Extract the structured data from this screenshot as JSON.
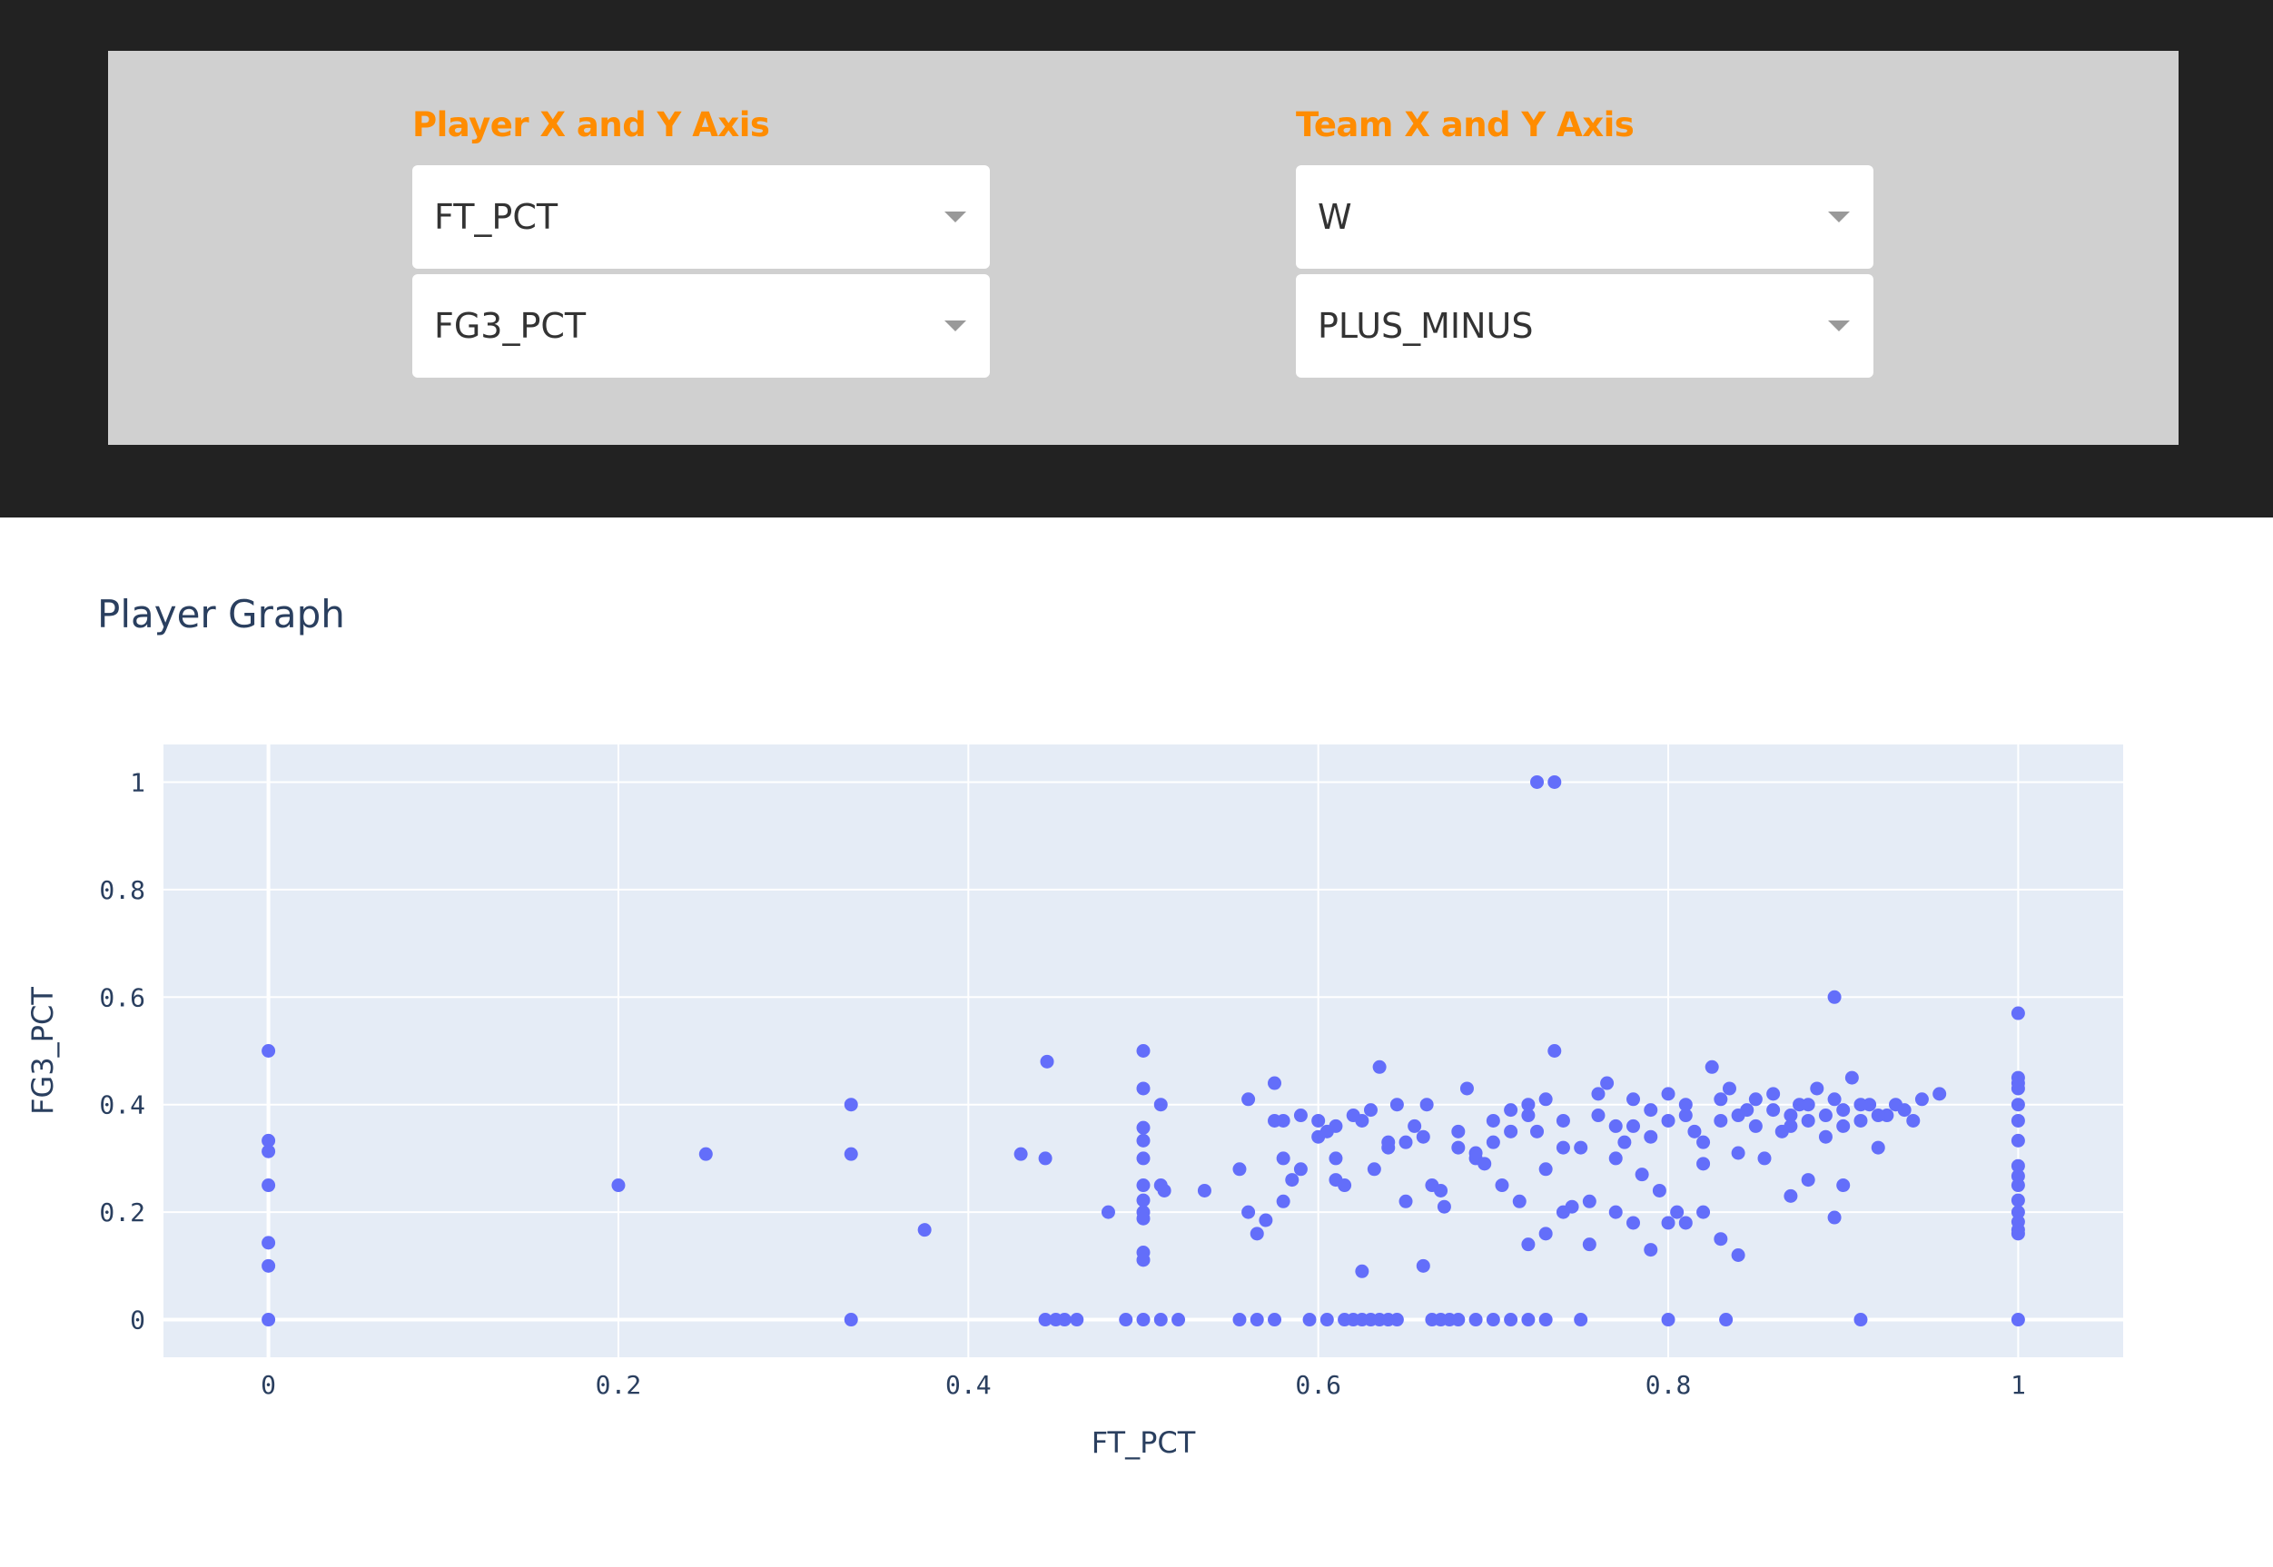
{
  "controls": {
    "player": {
      "label": "Player X and Y Axis",
      "x_value": "FT_PCT",
      "y_value": "FG3_PCT"
    },
    "team": {
      "label": "Team X and Y Axis",
      "x_value": "W",
      "y_value": "PLUS_MINUS"
    },
    "label_color": "#ff8c00"
  },
  "graph": {
    "title": "Player Graph"
  },
  "chart_data": {
    "type": "scatter",
    "title": "Player Graph",
    "xlabel": "FT_PCT",
    "ylabel": "FG3_PCT",
    "xlim": [
      -0.06,
      1.06
    ],
    "ylim": [
      -0.07,
      1.07
    ],
    "xticks": [
      0,
      0.2,
      0.4,
      0.6,
      0.8,
      1
    ],
    "yticks": [
      0,
      0.2,
      0.4,
      0.6,
      0.8,
      1
    ],
    "xtick_labels": [
      "0",
      "0.2",
      "0.4",
      "0.6",
      "0.8",
      "1"
    ],
    "ytick_labels": [
      "0",
      "0.2",
      "0.4",
      "0.6",
      "0.8",
      "1"
    ],
    "grid": true,
    "marker_color": "#636efa",
    "plot_bg": "#e5ecf6",
    "points": [
      [
        0,
        0.5
      ],
      [
        0,
        0.333
      ],
      [
        0,
        0.313
      ],
      [
        0,
        0.25
      ],
      [
        0,
        0.143
      ],
      [
        0,
        0.1
      ],
      [
        0,
        0
      ],
      [
        0.2,
        0.25
      ],
      [
        0.25,
        0.308
      ],
      [
        0.333,
        0.4
      ],
      [
        0.333,
        0.308
      ],
      [
        0.333,
        0
      ],
      [
        0.375,
        0.167
      ],
      [
        0.43,
        0.308
      ],
      [
        0.444,
        0.3
      ],
      [
        0.445,
        0.48
      ],
      [
        0.444,
        0
      ],
      [
        0.45,
        0
      ],
      [
        0.455,
        0
      ],
      [
        0.462,
        0
      ],
      [
        0.48,
        0.2
      ],
      [
        0.5,
        0.5
      ],
      [
        0.5,
        0.43
      ],
      [
        0.5,
        0.357
      ],
      [
        0.5,
        0.333
      ],
      [
        0.5,
        0.3
      ],
      [
        0.5,
        0.25
      ],
      [
        0.5,
        0.222
      ],
      [
        0.5,
        0.2
      ],
      [
        0.5,
        0.188
      ],
      [
        0.5,
        0.125
      ],
      [
        0.5,
        0.111
      ],
      [
        0.5,
        0
      ],
      [
        0.49,
        0
      ],
      [
        0.51,
        0
      ],
      [
        0.52,
        0
      ],
      [
        0.51,
        0.4
      ],
      [
        0.51,
        0.25
      ],
      [
        0.512,
        0.24
      ],
      [
        0.535,
        0.24
      ],
      [
        0.555,
        0.28
      ],
      [
        0.56,
        0.41
      ],
      [
        0.56,
        0.2
      ],
      [
        0.565,
        0.16
      ],
      [
        0.57,
        0.185
      ],
      [
        0.575,
        0.44
      ],
      [
        0.575,
        0.37
      ],
      [
        0.58,
        0.37
      ],
      [
        0.585,
        0.26
      ],
      [
        0.59,
        0.38
      ],
      [
        0.59,
        0.28
      ],
      [
        0.6,
        0.37
      ],
      [
        0.6,
        0.34
      ],
      [
        0.605,
        0.35
      ],
      [
        0.61,
        0.26
      ],
      [
        0.61,
        0.3
      ],
      [
        0.615,
        0.25
      ],
      [
        0.62,
        0.38
      ],
      [
        0.625,
        0.37
      ],
      [
        0.63,
        0.39
      ],
      [
        0.632,
        0.28
      ],
      [
        0.635,
        0.47
      ],
      [
        0.64,
        0.32
      ],
      [
        0.645,
        0.4
      ],
      [
        0.65,
        0.33
      ],
      [
        0.655,
        0.36
      ],
      [
        0.66,
        0.34
      ],
      [
        0.662,
        0.4
      ],
      [
        0.665,
        0.25
      ],
      [
        0.67,
        0.24
      ],
      [
        0.672,
        0.21
      ],
      [
        0.68,
        0.32
      ],
      [
        0.685,
        0.43
      ],
      [
        0.69,
        0.3
      ],
      [
        0.695,
        0.29
      ],
      [
        0.7,
        0.37
      ],
      [
        0.705,
        0.25
      ],
      [
        0.71,
        0.39
      ],
      [
        0.715,
        0.22
      ],
      [
        0.72,
        0.4
      ],
      [
        0.725,
        0.35
      ],
      [
        0.73,
        0.28
      ],
      [
        0.735,
        0.5
      ],
      [
        0.74,
        0.37
      ],
      [
        0.745,
        0.21
      ],
      [
        0.75,
        0.32
      ],
      [
        0.755,
        0.14
      ],
      [
        0.76,
        0.38
      ],
      [
        0.765,
        0.44
      ],
      [
        0.77,
        0.36
      ],
      [
        0.775,
        0.33
      ],
      [
        0.78,
        0.41
      ],
      [
        0.785,
        0.27
      ],
      [
        0.79,
        0.39
      ],
      [
        0.795,
        0.24
      ],
      [
        0.8,
        0.42
      ],
      [
        0.805,
        0.2
      ],
      [
        0.81,
        0.38
      ],
      [
        0.815,
        0.35
      ],
      [
        0.82,
        0.29
      ],
      [
        0.825,
        0.47
      ],
      [
        0.83,
        0.37
      ],
      [
        0.835,
        0.43
      ],
      [
        0.84,
        0.31
      ],
      [
        0.845,
        0.39
      ],
      [
        0.85,
        0.36
      ],
      [
        0.855,
        0.3
      ],
      [
        0.86,
        0.42
      ],
      [
        0.865,
        0.35
      ],
      [
        0.87,
        0.38
      ],
      [
        0.875,
        0.4
      ],
      [
        0.88,
        0.37
      ],
      [
        0.885,
        0.43
      ],
      [
        0.89,
        0.34
      ],
      [
        0.895,
        0.41
      ],
      [
        0.9,
        0.39
      ],
      [
        0.905,
        0.45
      ],
      [
        0.91,
        0.37
      ],
      [
        0.915,
        0.4
      ],
      [
        0.92,
        0.32
      ],
      [
        0.925,
        0.38
      ],
      [
        0.93,
        0.4
      ],
      [
        0.935,
        0.39
      ],
      [
        0.94,
        0.37
      ],
      [
        0.945,
        0.41
      ],
      [
        0.955,
        0.42
      ],
      [
        0.72,
        0.14
      ],
      [
        0.73,
        0.16
      ],
      [
        0.74,
        0.2
      ],
      [
        0.755,
        0.22
      ],
      [
        0.77,
        0.2
      ],
      [
        0.78,
        0.18
      ],
      [
        0.79,
        0.13
      ],
      [
        0.8,
        0.18
      ],
      [
        0.81,
        0.18
      ],
      [
        0.82,
        0.2
      ],
      [
        0.83,
        0.15
      ],
      [
        0.84,
        0.12
      ],
      [
        0.87,
        0.23
      ],
      [
        0.88,
        0.26
      ],
      [
        0.895,
        0.19
      ],
      [
        0.9,
        0.25
      ],
      [
        0.66,
        0.1
      ],
      [
        0.625,
        0.09
      ],
      [
        0.58,
        0.3
      ],
      [
        0.58,
        0.22
      ],
      [
        0.61,
        0.36
      ],
      [
        0.64,
        0.33
      ],
      [
        0.65,
        0.22
      ],
      [
        0.7,
        0.33
      ],
      [
        0.69,
        0.31
      ],
      [
        0.68,
        0.35
      ],
      [
        0.71,
        0.35
      ],
      [
        0.72,
        0.38
      ],
      [
        0.73,
        0.41
      ],
      [
        0.74,
        0.32
      ],
      [
        0.76,
        0.42
      ],
      [
        0.77,
        0.3
      ],
      [
        0.78,
        0.36
      ],
      [
        0.79,
        0.34
      ],
      [
        0.8,
        0.37
      ],
      [
        0.81,
        0.4
      ],
      [
        0.82,
        0.33
      ],
      [
        0.83,
        0.41
      ],
      [
        0.84,
        0.38
      ],
      [
        0.85,
        0.41
      ],
      [
        0.86,
        0.39
      ],
      [
        0.87,
        0.36
      ],
      [
        0.88,
        0.4
      ],
      [
        0.89,
        0.38
      ],
      [
        0.9,
        0.36
      ],
      [
        0.91,
        0.4
      ],
      [
        0.92,
        0.38
      ],
      [
        0.725,
        1
      ],
      [
        0.735,
        1
      ],
      [
        0.895,
        0.6
      ],
      [
        0.555,
        0
      ],
      [
        0.565,
        0
      ],
      [
        0.575,
        0
      ],
      [
        0.595,
        0
      ],
      [
        0.605,
        0
      ],
      [
        0.615,
        0
      ],
      [
        0.62,
        0
      ],
      [
        0.625,
        0
      ],
      [
        0.63,
        0
      ],
      [
        0.635,
        0
      ],
      [
        0.64,
        0
      ],
      [
        0.645,
        0
      ],
      [
        0.665,
        0
      ],
      [
        0.67,
        0
      ],
      [
        0.675,
        0
      ],
      [
        0.68,
        0
      ],
      [
        0.69,
        0
      ],
      [
        0.7,
        0
      ],
      [
        0.71,
        0
      ],
      [
        0.72,
        0
      ],
      [
        0.73,
        0
      ],
      [
        0.75,
        0
      ],
      [
        0.8,
        0
      ],
      [
        0.833,
        0
      ],
      [
        0.91,
        0
      ],
      [
        1,
        0.57
      ],
      [
        1,
        0.45
      ],
      [
        1,
        0.44
      ],
      [
        1,
        0.43
      ],
      [
        1,
        0.4
      ],
      [
        1,
        0.37
      ],
      [
        1,
        0.333
      ],
      [
        1,
        0.286
      ],
      [
        1,
        0.267
      ],
      [
        1,
        0.25
      ],
      [
        1,
        0.222
      ],
      [
        1,
        0.2
      ],
      [
        1,
        0.182
      ],
      [
        1,
        0.167
      ],
      [
        1,
        0.16
      ],
      [
        1,
        0
      ]
    ]
  }
}
